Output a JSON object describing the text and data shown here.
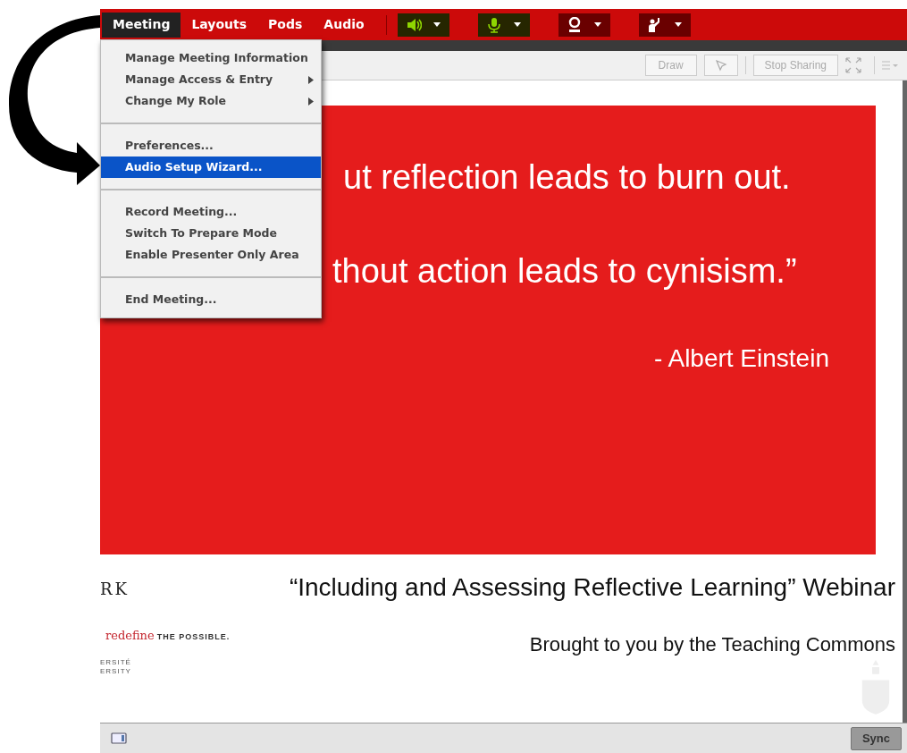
{
  "menubar": [
    {
      "label": "Meeting",
      "selected": true
    },
    {
      "label": "Layouts",
      "selected": false
    },
    {
      "label": "Pods",
      "selected": false
    },
    {
      "label": "Audio",
      "selected": false
    }
  ],
  "media_buttons": [
    {
      "kind": "speaker",
      "on": true
    },
    {
      "kind": "microphone",
      "on": true
    },
    {
      "kind": "camera",
      "on": false
    },
    {
      "kind": "hand",
      "on": false
    }
  ],
  "menu": [
    {
      "kind": "item",
      "label": "Manage Meeting Information",
      "submenu": false,
      "selected": false
    },
    {
      "kind": "item",
      "label": "Manage Access & Entry",
      "submenu": true,
      "selected": false
    },
    {
      "kind": "item",
      "label": "Change My Role",
      "submenu": true,
      "selected": false
    },
    {
      "kind": "separator"
    },
    {
      "kind": "item",
      "label": "Preferences...",
      "submenu": false,
      "selected": false
    },
    {
      "kind": "item",
      "label": "Audio Setup Wizard...",
      "submenu": false,
      "selected": true
    },
    {
      "kind": "separator"
    },
    {
      "kind": "item",
      "label": "Record Meeting...",
      "submenu": false,
      "selected": false
    },
    {
      "kind": "item",
      "label": "Switch To Prepare Mode",
      "submenu": false,
      "selected": false
    },
    {
      "kind": "item",
      "label": "Enable Presenter Only Area",
      "submenu": false,
      "selected": false
    },
    {
      "kind": "separator"
    },
    {
      "kind": "item",
      "label": "End Meeting...",
      "submenu": false,
      "selected": false
    }
  ],
  "pod_toolbar": {
    "draw": {
      "label": "Draw",
      "disabled": true
    },
    "stop_sharing": {
      "label": "Stop Sharing",
      "disabled": true
    }
  },
  "slide": {
    "quote_lines": [
      "ut reflection leads to burn out.",
      "thout action leads to cynisism.”"
    ],
    "attribution": "- Albert Einstein",
    "title": "“Including and Assessing Reflective Learning” Webinar",
    "subtitle": "Brought to you by the Teaching Commons",
    "logo": {
      "wordmark": "RK",
      "tagline_script": "redefine",
      "tagline": "THE POSSIBLE.",
      "lines": [
        "ERSITÉ",
        "ERSITY"
      ]
    }
  },
  "status_bar": {
    "sync": "Sync"
  }
}
